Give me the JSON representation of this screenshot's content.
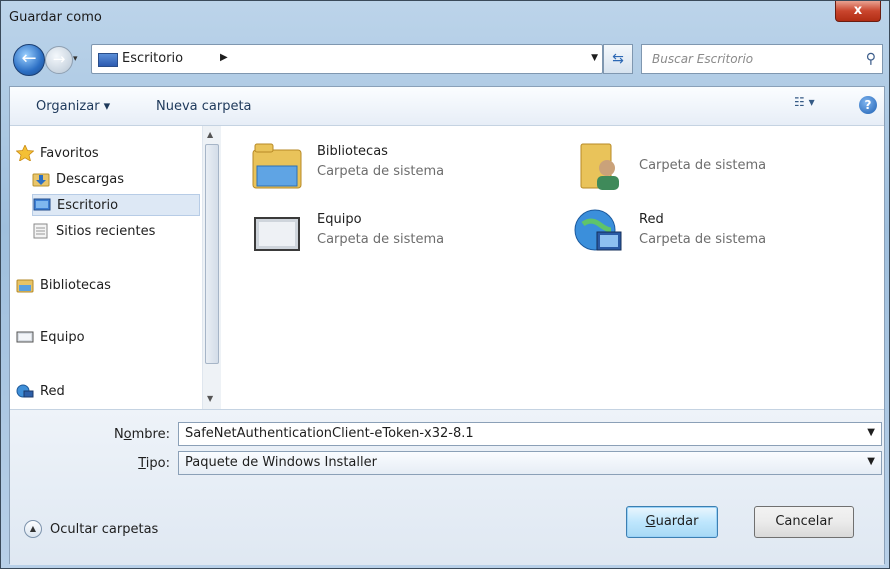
{
  "window": {
    "title": "Guardar como",
    "close_label": "x"
  },
  "navbar": {
    "address": "Escritorio",
    "search_placeholder": "Buscar Escritorio"
  },
  "toolbar": {
    "organize": "Organizar ▾",
    "new_folder": "Nueva carpeta"
  },
  "nav_pane": {
    "items": [
      {
        "label": "Favoritos",
        "icon": "star-icon"
      },
      {
        "label": "Descargas",
        "icon": "download-folder-icon"
      },
      {
        "label": "Escritorio",
        "icon": "desktop-icon",
        "selected": true
      },
      {
        "label": "Sitios recientes",
        "icon": "recent-places-icon"
      },
      {
        "label": "Bibliotecas",
        "icon": "libraries-icon"
      },
      {
        "label": "Equipo",
        "icon": "computer-icon"
      },
      {
        "label": "Red",
        "icon": "network-icon"
      }
    ]
  },
  "content": {
    "items": [
      {
        "name": "Bibliotecas",
        "desc": "Carpeta de sistema",
        "icon": "libraries-icon"
      },
      {
        "name": "",
        "desc": "Carpeta de sistema",
        "icon": "user-folder-icon"
      },
      {
        "name": "Equipo",
        "desc": "Carpeta de sistema",
        "icon": "computer-icon"
      },
      {
        "name": "Red",
        "desc": "Carpeta de sistema",
        "icon": "network-icon"
      }
    ]
  },
  "form": {
    "name_label_pre": "N",
    "name_label_u": "o",
    "name_label_post": "mbre:",
    "name_value": "SafeNetAuthenticationClient-eToken-x32-8.1",
    "type_label_u": "T",
    "type_label_post": "ipo:",
    "type_value": "Paquete de Windows Installer"
  },
  "footer": {
    "hide_folders": "Ocultar carpetas",
    "save_u": "G",
    "save_post": "uardar",
    "cancel": "Cancelar"
  },
  "colors": {
    "accent": "#1e395b",
    "selection": "#dde8f5"
  }
}
